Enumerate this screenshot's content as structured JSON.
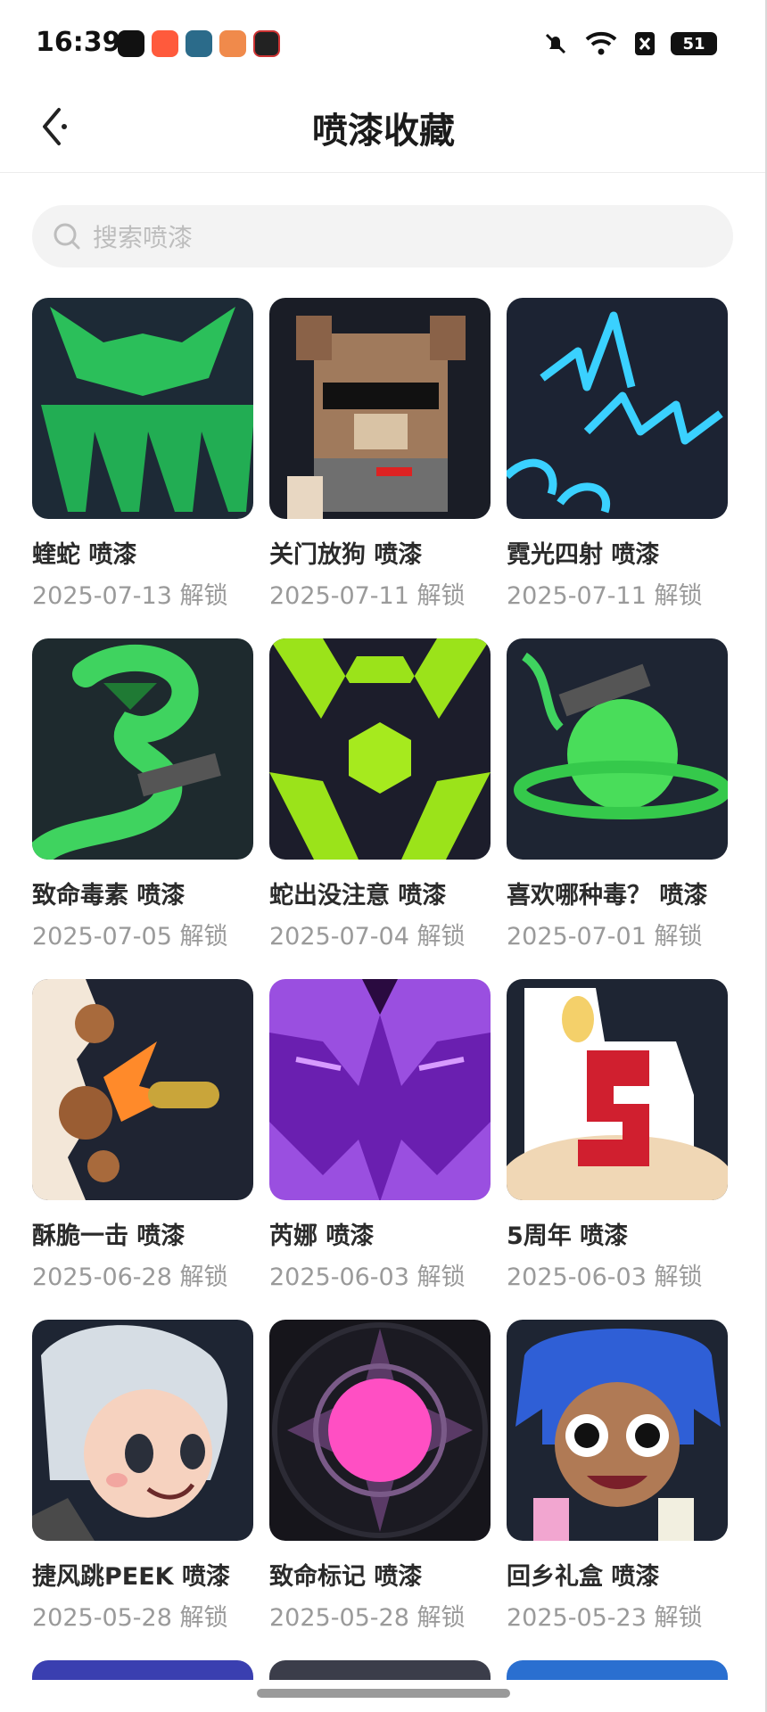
{
  "status_bar": {
    "time": "16:39",
    "battery": "51"
  },
  "header": {
    "title": "喷漆收藏"
  },
  "search": {
    "placeholder": "搜索喷漆"
  },
  "items": [
    {
      "name": "蝰蛇 喷漆",
      "date": "2025-07-13 解锁"
    },
    {
      "name": "关门放狗 喷漆",
      "date": "2025-07-11 解锁"
    },
    {
      "name": "霓光四射 喷漆",
      "date": "2025-07-11 解锁"
    },
    {
      "name": "致命毒素 喷漆",
      "date": "2025-07-05 解锁"
    },
    {
      "name": "蛇出没注意 喷漆",
      "date": "2025-07-04 解锁"
    },
    {
      "name": "喜欢哪种毒？ 喷漆",
      "date": "2025-07-01 解锁"
    },
    {
      "name": "酥脆一击 喷漆",
      "date": "2025-06-28 解锁"
    },
    {
      "name": "芮娜 喷漆",
      "date": "2025-06-03 解锁"
    },
    {
      "name": "5周年 喷漆",
      "date": "2025-06-03 解锁"
    },
    {
      "name": "捷风跳PEEK 喷漆",
      "date": "2025-05-28 解锁"
    },
    {
      "name": "致命标记 喷漆",
      "date": "2025-05-28 解锁"
    },
    {
      "name": "回乡礼盒 喷漆",
      "date": "2025-05-23 解锁"
    }
  ]
}
